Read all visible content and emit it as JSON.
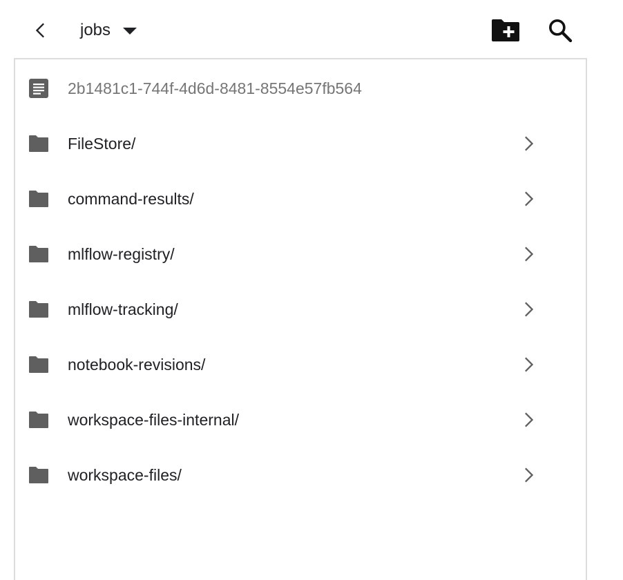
{
  "header": {
    "back_icon": "chevron-left-icon",
    "path_label": "jobs",
    "dropdown_icon": "caret-down-icon",
    "new_folder_icon": "create-new-folder-icon",
    "search_icon": "search-icon"
  },
  "list": {
    "items": [
      {
        "label": "2b1481c1-744f-4d6d-8481-8554e57fb564",
        "type": "file",
        "icon": "file-icon"
      },
      {
        "label": "FileStore/",
        "type": "folder",
        "icon": "folder-icon"
      },
      {
        "label": "command-results/",
        "type": "folder",
        "icon": "folder-icon"
      },
      {
        "label": "mlflow-registry/",
        "type": "folder",
        "icon": "folder-icon"
      },
      {
        "label": "mlflow-tracking/",
        "type": "folder",
        "icon": "folder-icon"
      },
      {
        "label": "notebook-revisions/",
        "type": "folder",
        "icon": "folder-icon"
      },
      {
        "label": "workspace-files-internal/",
        "type": "folder",
        "icon": "folder-icon"
      },
      {
        "label": "workspace-files/",
        "type": "folder",
        "icon": "folder-icon"
      }
    ]
  },
  "colors": {
    "icon_gray": "#5f5f5f",
    "text_primary": "#202124",
    "text_secondary": "#767676",
    "border": "#dcdcdc"
  }
}
